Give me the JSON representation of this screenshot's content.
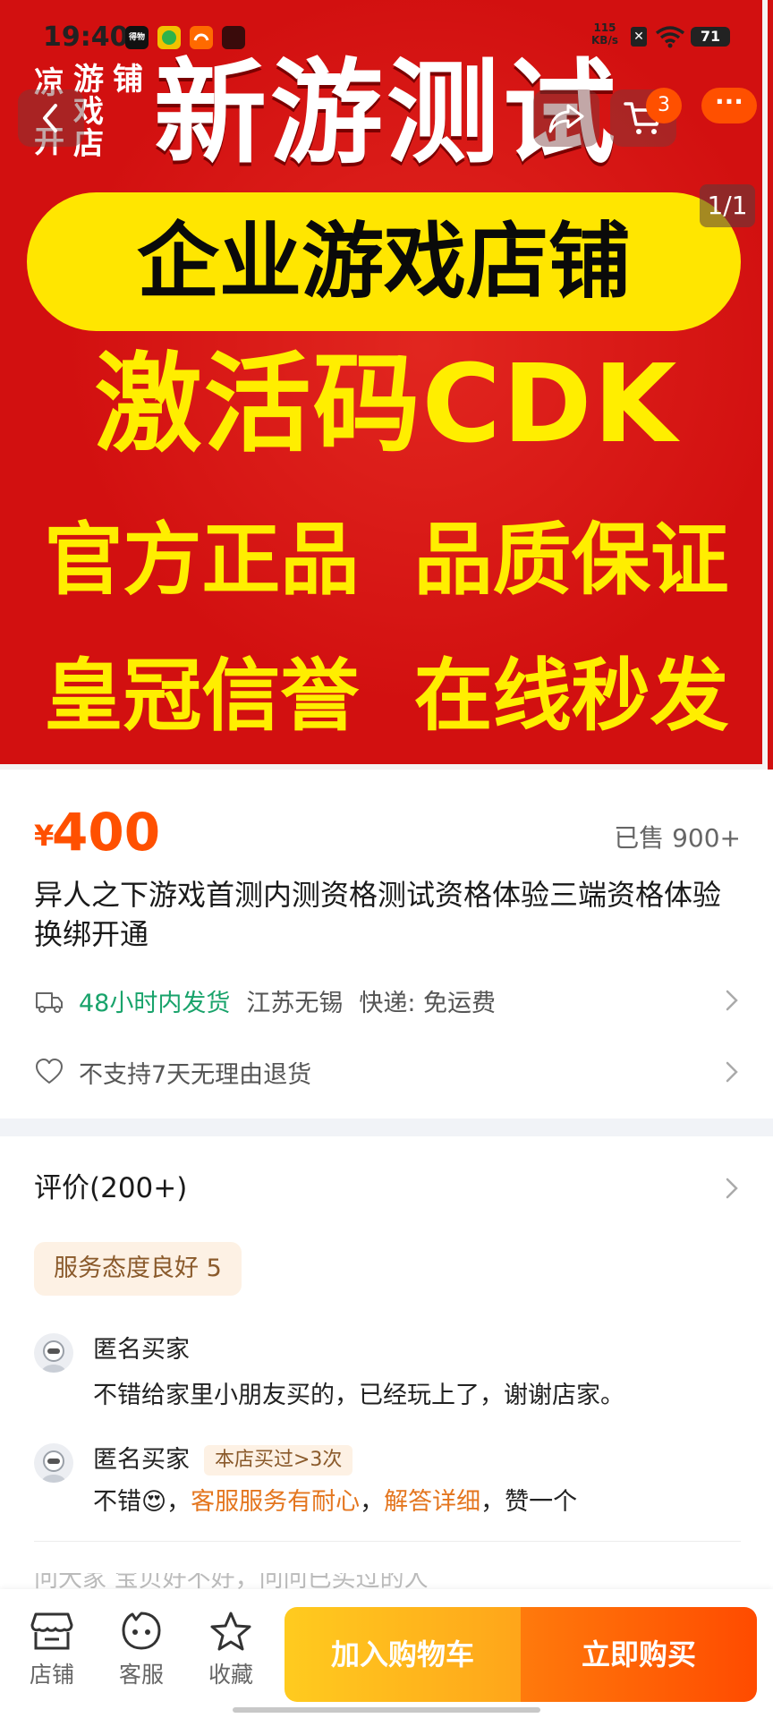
{
  "status_bar": {
    "time": "19:40",
    "apps": [
      {
        "icon": "dewu-app-icon",
        "label": "得物"
      },
      {
        "icon": "green-app-icon",
        "label": ""
      },
      {
        "icon": "taobao-app-icon",
        "label": ""
      },
      {
        "icon": "dark-app-icon",
        "label": ""
      }
    ],
    "net_speed_value": "115",
    "net_speed_unit": "KB/s",
    "battery": "71"
  },
  "hero": {
    "shop_logo_chars": [
      "凉",
      "游",
      "铺",
      "开",
      "戏",
      "店"
    ],
    "title": "新游测试",
    "pill_text": "企业游戏店铺",
    "line1": "激活码CDK",
    "line2": "官方正品  品质保证",
    "line3": "皇冠信誉  在线秒发",
    "cart_count": "3",
    "more_label": "···",
    "page_indicator": "1/1"
  },
  "product": {
    "currency": "¥",
    "price": "400",
    "sold": "已售 900+",
    "title": "异人之下游戏首测内测资格测试资格体验三端资格体验换绑开通"
  },
  "shipping": {
    "time": "48小时内发货",
    "location": "江苏无锡",
    "express": "快递: 免运费"
  },
  "returns": {
    "text": "不支持7天无理由退货"
  },
  "reviews": {
    "header": "评价(200+)",
    "tag": "服务态度良好 5",
    "items": [
      {
        "name": "匿名买家",
        "badge": "",
        "text": "不错给家里小朋友买的，已经玩上了，谢谢店家。"
      },
      {
        "name": "匿名买家",
        "badge": "本店买过>3次",
        "text_prefix": "不错",
        "emoji": "😍",
        "sep1": "，",
        "hl1": "客服服务有耐心",
        "sep2": "，",
        "hl2": "解答详细",
        "text_suffix": "，赞一个"
      }
    ],
    "cut_off_text": "问大家   宝贝好不好，问问已买过的人"
  },
  "bottom_bar": {
    "store": "店铺",
    "service": "客服",
    "favorite": "收藏",
    "add_to_cart": "加入购物车",
    "buy_now": "立即购买"
  },
  "colors": {
    "accent_orange": "#ff5000",
    "green": "#19a36b",
    "hero_red": "#d21010",
    "hero_yellow": "#ffe600"
  }
}
